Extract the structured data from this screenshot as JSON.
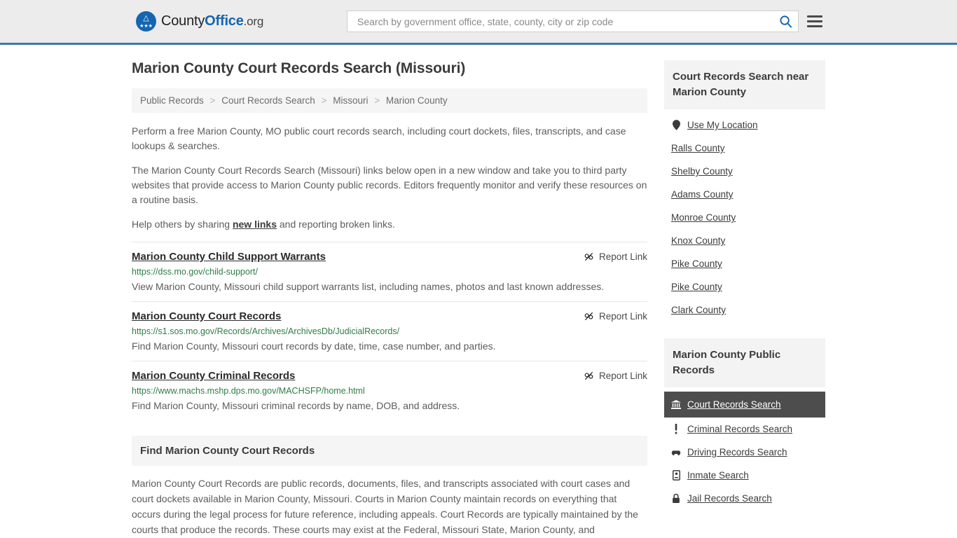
{
  "header": {
    "logo": {
      "part1": "County",
      "part2": "Office",
      "part3": ".org",
      "emblem_icon": "eagle-seal-icon"
    },
    "search": {
      "placeholder": "Search by government office, state, county, city or zip code",
      "value": "",
      "icon": "search-icon"
    },
    "menu_icon": "hamburger-menu-icon",
    "accent_color": "#3a77b0"
  },
  "main": {
    "title": "Marion County Court Records Search (Missouri)",
    "breadcrumb": [
      "Public Records",
      "Court Records Search",
      "Missouri",
      "Marion County"
    ],
    "breadcrumb_separator": ">",
    "intro_paragraphs": [
      "Perform a free Marion County, MO public court records search, including court dockets, files, transcripts, and case lookups & searches.",
      "The Marion County Court Records Search (Missouri) links below open in a new window and take you to third party websites that provide access to Marion County public records. Editors frequently monitor and verify these resources on a routine basis."
    ],
    "help_line": {
      "before": "Help others by sharing ",
      "link": "new links",
      "after": " and reporting broken links."
    },
    "report_link_label": "Report Link",
    "report_link_icon": "broken-link-icon",
    "results": [
      {
        "title": "Marion County Child Support Warrants",
        "url": "https://dss.mo.gov/child-support/",
        "description": "View Marion County, Missouri child support warrants list, including names, photos and last known addresses."
      },
      {
        "title": "Marion County Court Records",
        "url": "https://s1.sos.mo.gov/Records/Archives/ArchivesDb/JudicialRecords/",
        "description": "Find Marion County, Missouri court records by date, time, case number, and parties."
      },
      {
        "title": "Marion County Criminal Records",
        "url": "https://www.machs.mshp.dps.mo.gov/MACHSFP/home.html",
        "description": "Find Marion County, Missouri criminal records by name, DOB, and address."
      }
    ],
    "section": {
      "heading": "Find Marion County Court Records",
      "body": "Marion County Court Records are public records, documents, files, and transcripts associated with court cases and court dockets available in Marion County, Missouri. Courts in Marion County maintain records on everything that occurs during the legal process for future reference, including appeals. Court Records are typically maintained by the courts that produce the records. These courts may exist at the Federal, Missouri State, Marion County, and"
    }
  },
  "sidebar": {
    "nearby_card": {
      "heading": "Court Records Search near Marion County",
      "use_my_location": {
        "label": "Use My Location",
        "icon": "map-pin-icon"
      },
      "counties": [
        "Ralls County",
        "Shelby County",
        "Adams County",
        "Monroe County",
        "Knox County",
        "Pike County",
        "Pike County",
        "Clark County"
      ]
    },
    "public_records_card": {
      "heading": "Marion County Public Records",
      "items": [
        {
          "label": "Court Records Search",
          "icon": "courthouse-icon",
          "active": true
        },
        {
          "label": "Criminal Records Search",
          "icon": "exclamation-icon",
          "active": false
        },
        {
          "label": "Driving Records Search",
          "icon": "car-icon",
          "active": false
        },
        {
          "label": "Inmate Search",
          "icon": "id-badge-icon",
          "active": false
        },
        {
          "label": "Jail Records Search",
          "icon": "lock-icon",
          "active": false
        }
      ],
      "active_bg": "#4d4d4d"
    }
  }
}
